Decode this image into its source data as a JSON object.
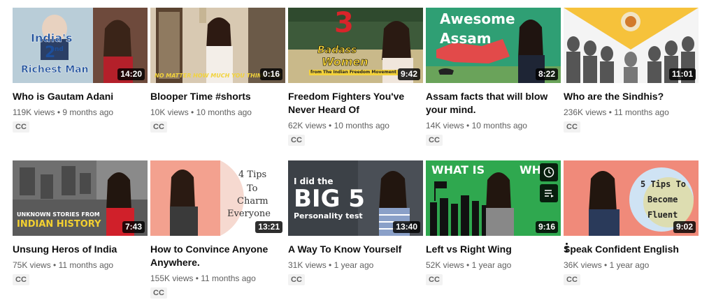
{
  "videos": [
    {
      "title": "Who is Gautam Adani",
      "views": "119K views",
      "age": "9 months ago",
      "duration": "14:20",
      "cc": "CC",
      "thumb_text": [
        "India's",
        "2",
        "nd",
        "Richest Man"
      ]
    },
    {
      "title": "Blooper Time #shorts",
      "views": "10K views",
      "age": "10 months ago",
      "duration": "0:16",
      "cc": "CC",
      "thumb_text": [
        "NO MATTER HOW MUCH YOU THINK YOU"
      ]
    },
    {
      "title": "Freedom Fighters You've Never Heard Of",
      "views": "62K views",
      "age": "10 months ago",
      "duration": "9:42",
      "cc": "CC",
      "thumb_text": [
        "3",
        "Badass",
        "Women",
        "from The Indian Freedom Movement"
      ]
    },
    {
      "title": "Assam facts that will blow your mind.",
      "views": "14K views",
      "age": "10 months ago",
      "duration": "8:22",
      "cc": "CC",
      "thumb_text": [
        "Awesome",
        "Assam"
      ]
    },
    {
      "title": "Who are the Sindhis?",
      "views": "236K views",
      "age": "11 months ago",
      "duration": "11:01",
      "cc": "CC",
      "thumb_text": []
    },
    {
      "title": "Unsung Heros of India",
      "views": "75K views",
      "age": "11 months ago",
      "duration": "7:43",
      "cc": "CC",
      "thumb_text": [
        "UNKNOWN STORIES FROM",
        "INDIAN HISTORY"
      ]
    },
    {
      "title": "How to Convince Anyone Anywhere.",
      "views": "155K views",
      "age": "11 months ago",
      "duration": "13:21",
      "cc": "CC",
      "thumb_text": [
        "4 Tips",
        "To",
        "Charm",
        "Everyone"
      ]
    },
    {
      "title": "A Way To Know Yourself",
      "views": "31K views",
      "age": "1 year ago",
      "duration": "13:40",
      "cc": "CC",
      "thumb_text": [
        "I did the",
        "BIG 5",
        "Personality test"
      ]
    },
    {
      "title": "Left vs Right Wing",
      "views": "52K views",
      "age": "1 year ago",
      "duration": "9:16",
      "cc": "CC",
      "thumb_text": [
        "WHAT IS",
        "WH"
      ]
    },
    {
      "title": "Speak Confident English",
      "views": "36K views",
      "age": "1 year ago",
      "duration": "9:02",
      "cc": "CC",
      "thumb_text": [
        "5 Tips To",
        "Become",
        "Fluent"
      ]
    }
  ],
  "separator": "•",
  "icons": {
    "more": "more-vertical-icon",
    "watch_later": "clock-icon",
    "queue": "add-to-queue-icon"
  }
}
